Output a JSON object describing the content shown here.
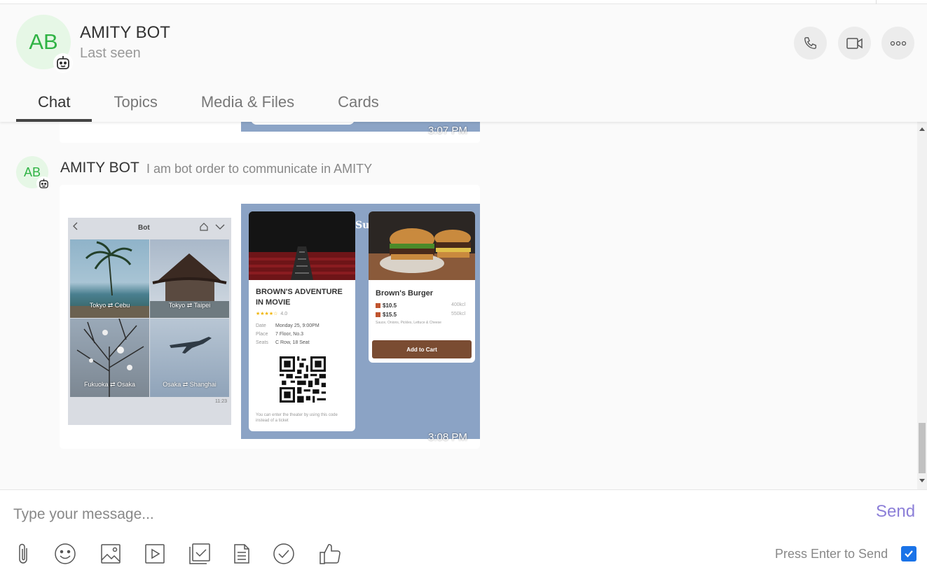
{
  "header": {
    "avatar_initials": "AB",
    "name": "AMITY BOT",
    "status": "Last seen",
    "actions": [
      "phone-icon",
      "video-icon",
      "more-icon"
    ]
  },
  "tabs": [
    {
      "label": "Chat",
      "active": true
    },
    {
      "label": "Topics",
      "active": false
    },
    {
      "label": "Media & Files",
      "active": false
    },
    {
      "label": "Cards",
      "active": false
    }
  ],
  "messages": [
    {
      "time": "3:07 PM"
    },
    {
      "avatar_initials": "AB",
      "sender": "AMITY BOT",
      "caption": "I am bot order to communicate in AMITY",
      "time": "3:08 PM",
      "phone": {
        "title": "Bot",
        "tiles": [
          "Tokyo ⇄ Cebu",
          "Tokyo ⇄ Taipei",
          "Fukuoka ⇄ Osaka",
          "Osaka ⇄ Shanghai"
        ],
        "stamp": "11:23"
      },
      "promo": {
        "headline": "Summer 2020",
        "movie": {
          "title": "BROWN'S ADVENTURE IN MOVIE",
          "rating": "4.0",
          "date_label": "Date",
          "date": "Monday 25, 9:00PM",
          "place_label": "Place",
          "place": "7 Floor, No.3",
          "seats_label": "Seats",
          "seats": "C Row, 18 Seat",
          "note": "You can enter the theater by using this code instead of a ticket"
        },
        "burger": {
          "title": "Brown's Burger",
          "price1": "$10.5",
          "cal1": "400kcl",
          "price2": "$15.5",
          "cal2": "550kcl",
          "ingredients": "Sauce, Onions, Pickles, Lettuce & Cheese",
          "button": "Add to Cart"
        }
      }
    }
  ],
  "composer": {
    "placeholder": "Type your message...",
    "send_label": "Send",
    "enter_label": "Press Enter to Send",
    "enter_checked": true,
    "tools": [
      "attach-icon",
      "emoji-icon",
      "image-icon",
      "video-icon",
      "checklist-icon",
      "document-icon",
      "check-circle-icon",
      "thumbs-up-icon"
    ]
  }
}
